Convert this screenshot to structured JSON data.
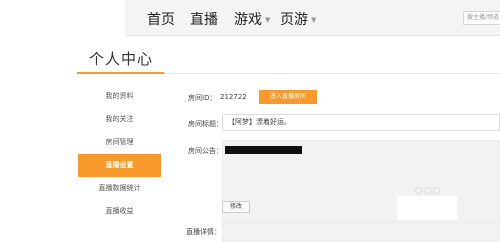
{
  "nav": {
    "home": "首页",
    "live": "直播",
    "games": "游戏",
    "mobile_games": "页游",
    "search_placeholder": "搜主播/频道"
  },
  "page_title": "个人中心",
  "sidebar": {
    "items": [
      {
        "label": "我的资料",
        "active": false
      },
      {
        "label": "我的关注",
        "active": false
      },
      {
        "label": "房间管理",
        "active": false
      },
      {
        "label": "直播设置",
        "active": true
      },
      {
        "label": "直播数据统计",
        "active": false
      },
      {
        "label": "直播收益",
        "active": false
      }
    ]
  },
  "form": {
    "room_id_label": "房间ID：",
    "room_id_value": "212722",
    "enter_room_button": "进入直播房间",
    "room_title_label": "房间标题：",
    "room_title_value": "【阿梦】漂着好运。",
    "notice_label": "房间公告：",
    "edit_button": "修改",
    "detail_label": "直播详情："
  },
  "colors": {
    "accent": "#f79a2b",
    "topbar_bg": "#f4f4f4",
    "input_bg": "#f2f2f2"
  }
}
